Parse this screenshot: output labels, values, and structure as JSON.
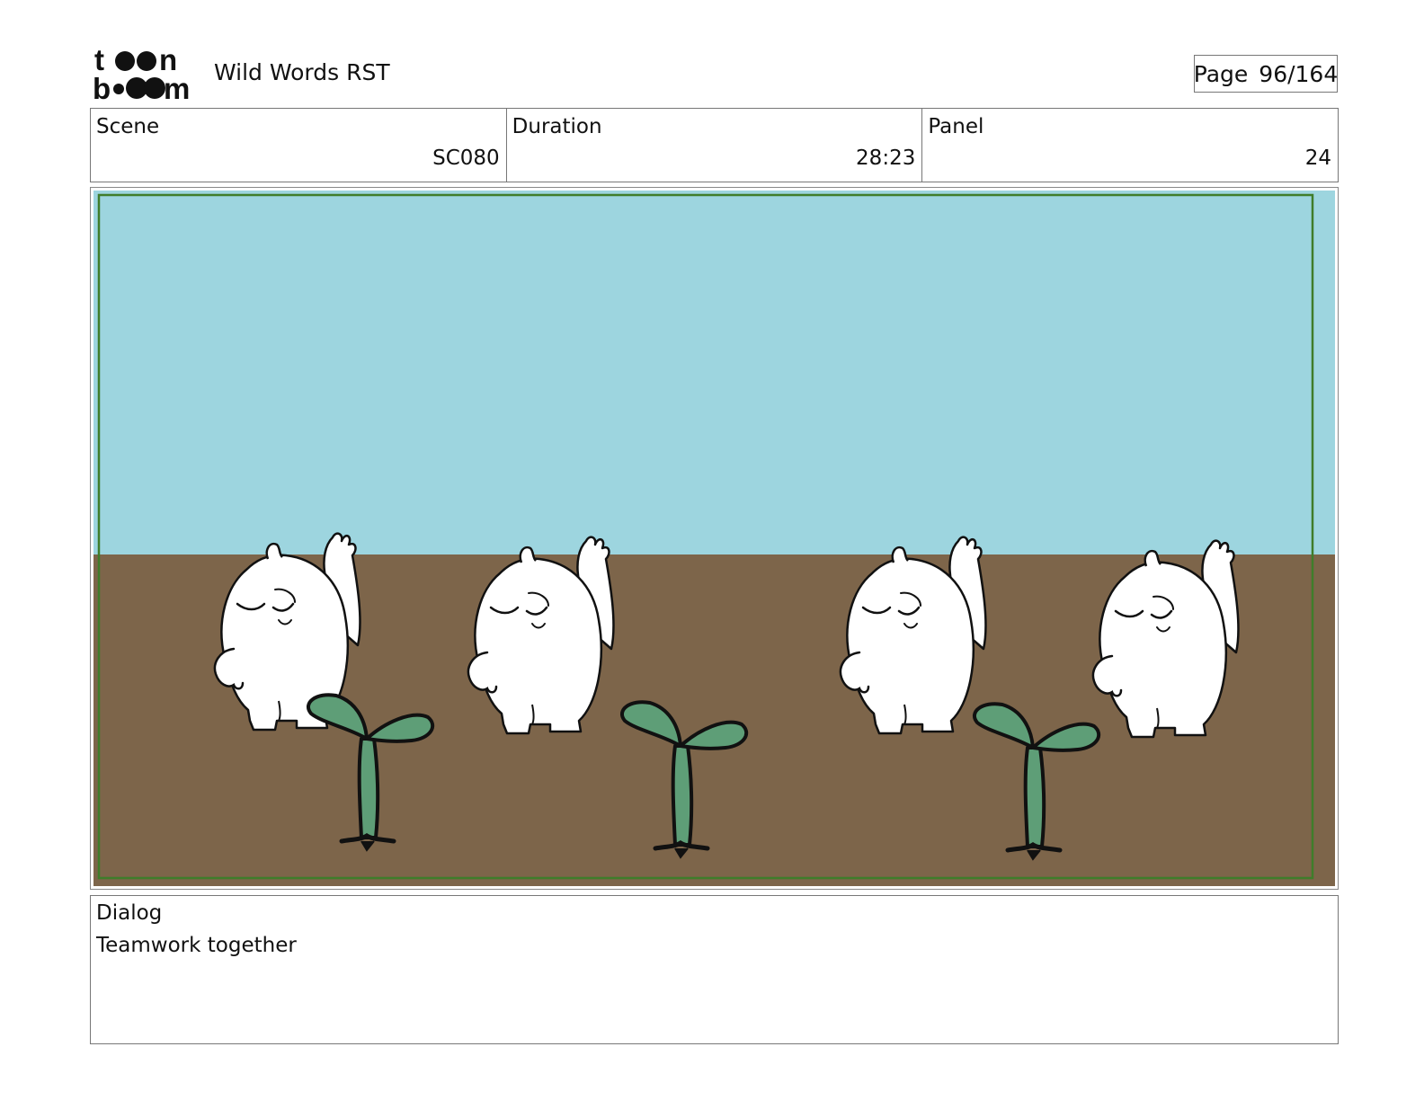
{
  "header": {
    "logo_text": "toon boom",
    "project_title": "Wild Words RST",
    "page_label": "Page",
    "page_number": "96/164"
  },
  "info": {
    "scene_label": "Scene",
    "scene_value": "SC080",
    "duration_label": "Duration",
    "duration_value": "28:23",
    "panel_label": "Panel",
    "panel_value": "24"
  },
  "frame": {
    "sky_color": "#9dd5df",
    "ground_color": "#7d654a",
    "border_color": "#3f7d2a",
    "sprout_color": "#5e9e77",
    "character_count": 4,
    "sprout_count": 3
  },
  "dialog": {
    "label": "Dialog",
    "text": "Teamwork together"
  }
}
